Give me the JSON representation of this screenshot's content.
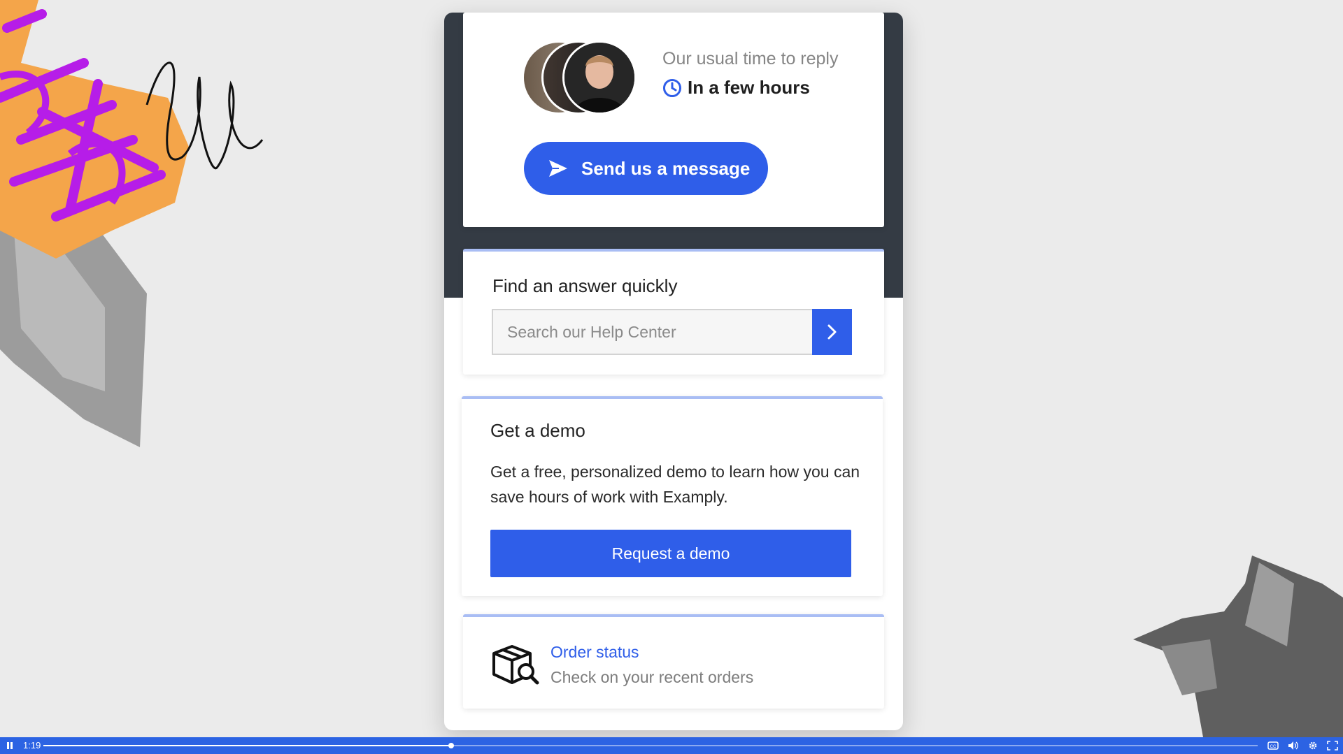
{
  "reply": {
    "label": "Our usual time to reply",
    "time": "In a few hours",
    "send_button": "Send us a message"
  },
  "search": {
    "title": "Find an answer quickly",
    "placeholder": "Search our Help Center"
  },
  "demo": {
    "title": "Get a demo",
    "description": "Get a free, personalized demo to learn how you can save hours of work with Examply.",
    "button": "Request a demo"
  },
  "order": {
    "link": "Order status",
    "subtitle": "Check on your recent orders"
  },
  "player": {
    "time": "1:19",
    "progress": 0.336
  },
  "colors": {
    "accent": "#2f5ee9",
    "header_bg": "#343b44",
    "player_bar": "#2c63e3"
  },
  "icons": [
    "clock-icon",
    "send-icon",
    "chevron-right-icon",
    "package-search-icon",
    "pause-icon",
    "captions-icon",
    "volume-icon",
    "settings-icon",
    "fullscreen-icon"
  ]
}
